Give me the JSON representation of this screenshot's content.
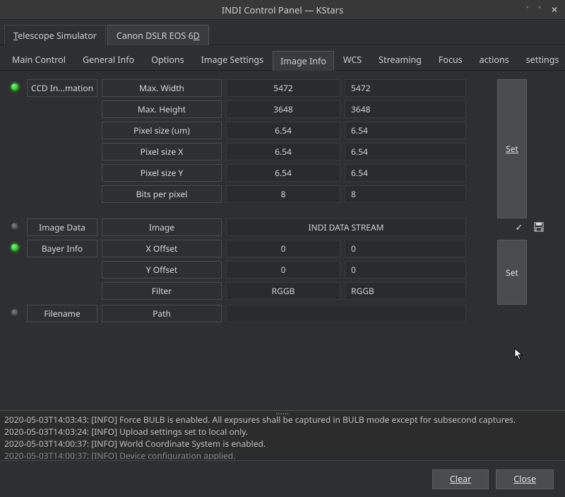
{
  "window": {
    "title": "INDI Control Panel — KStars"
  },
  "deviceTabs": {
    "items": [
      {
        "label_pre": "",
        "ul": "T",
        "label_post": "elescope Simulator"
      },
      {
        "label_pre": "Canon DSLR EOS 6",
        "ul": "D",
        "label_post": ""
      }
    ],
    "activeIndex": 1
  },
  "propTabs": {
    "items": [
      {
        "pre": "",
        "ul": "M",
        "post": "ain Control"
      },
      {
        "pre": "",
        "ul": "G",
        "post": "eneral Info"
      },
      {
        "pre": "",
        "ul": "O",
        "post": "ptions"
      },
      {
        "pre": "",
        "ul": "I",
        "post": "mage Settings"
      },
      {
        "pre": "Image Info",
        "ul": "",
        "post": ""
      },
      {
        "pre": "",
        "ul": "W",
        "post": "CS"
      },
      {
        "pre": "S",
        "ul": "t",
        "post": "reaming"
      },
      {
        "pre": "",
        "ul": "F",
        "post": "ocus"
      },
      {
        "pre": "",
        "ul": "a",
        "post": "ctions"
      },
      {
        "pre": "settings",
        "ul": "",
        "post": ""
      }
    ],
    "activeIndex": 4
  },
  "groups": {
    "ccd": {
      "label": "CCD In...mation",
      "led": "green",
      "rows": [
        {
          "label": "Max. Width",
          "ro": "5472",
          "rw": "5472"
        },
        {
          "label": "Max. Height",
          "ro": "3648",
          "rw": "3648"
        },
        {
          "label": "Pixel size (um)",
          "ro": "6.54",
          "rw": "6.54"
        },
        {
          "label": "Pixel size X",
          "ro": "6.54",
          "rw": "6.54"
        },
        {
          "label": "Pixel size Y",
          "ro": "6.54",
          "rw": "6.54"
        },
        {
          "label": "Bits per pixel",
          "ro": "8",
          "rw": "8"
        }
      ],
      "setLabel": "Set"
    },
    "imageData": {
      "label": "Image Data",
      "led": "gray",
      "propLabel": "Image",
      "value": "INDI DATA STREAM"
    },
    "bayer": {
      "label": "Bayer Info",
      "led": "green",
      "rows": [
        {
          "label": "X Offset",
          "ro": "0",
          "rw": "0"
        },
        {
          "label": "Y Offset",
          "ro": "0",
          "rw": "0"
        },
        {
          "label": "Filter",
          "ro": "RGGB",
          "rw": "RGGB"
        }
      ],
      "setLabel": "Set"
    },
    "filename": {
      "label": "Filename",
      "led": "gray",
      "propLabel": "Path",
      "value": ""
    }
  },
  "log": {
    "lines": [
      "2020-05-03T14:03:43: [INFO] Force BULB is enabled. All expsures shall be captured in BULB mode except for subsecond captures.",
      "2020-05-03T14:03:24: [INFO] Upload settings set to local only.",
      "2020-05-03T14:00:37: [INFO] World Coordinate System is enabled.",
      "2020-05-03T14:00:37: [INFO] Device configuration applied."
    ]
  },
  "buttons": {
    "clear": "Clear",
    "close": "Close"
  }
}
